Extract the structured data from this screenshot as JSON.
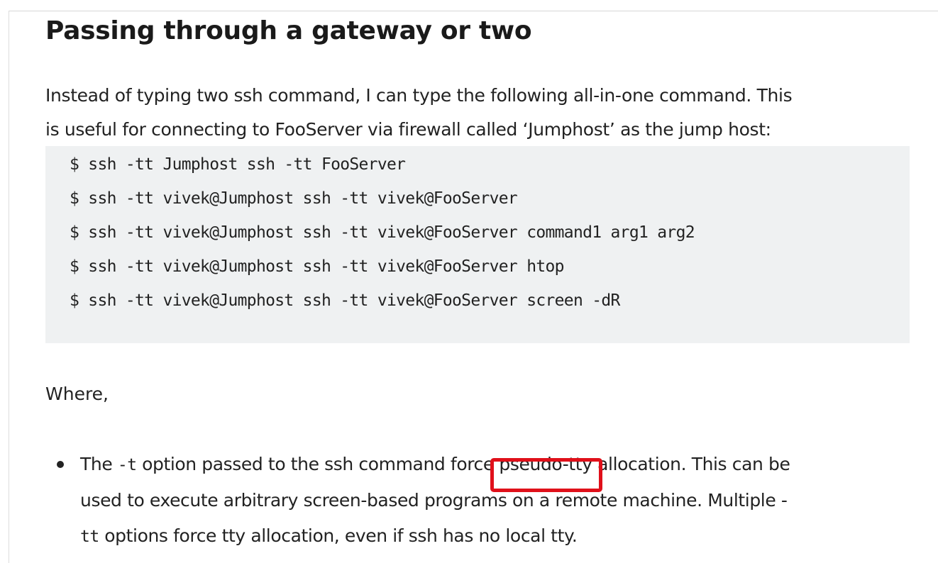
{
  "article": {
    "heading": "Passing through a gateway or two",
    "intro_lines": [
      "Instead of typing two ssh command, I can type the following all-in-one command. This",
      "is useful for connecting to FooServer via firewall called ‘Jumphost’ as the jump host:"
    ],
    "code_lines": [
      "$ ssh -tt Jumphost ssh -tt FooServer",
      "$ ssh -tt vivek@Jumphost ssh -tt vivek@FooServer",
      "$ ssh -tt vivek@Jumphost ssh -tt vivek@FooServer command1 arg1 arg2",
      "$ ssh -tt vivek@Jumphost ssh -tt vivek@FooServer htop",
      "$ ssh -tt vivek@Jumphost ssh -tt vivek@FooServer screen -dR"
    ],
    "where_label": "Where,",
    "bullet": {
      "pre_1": "The ",
      "code_t": "-t",
      "mid_1": " option passed to the ssh command force ",
      "highlight_text": "pseudo-tty",
      "post_1": " allocation. This can be",
      "line_2": "used to execute arbitrary screen-based programs on a remote machine. Multiple -",
      "code_tt": "tt",
      "line_3_rest": " options force tty allocation, even if ssh has no local tty."
    }
  },
  "colors": {
    "highlight_box": "#e0101a",
    "code_background": "#eff1f2"
  }
}
